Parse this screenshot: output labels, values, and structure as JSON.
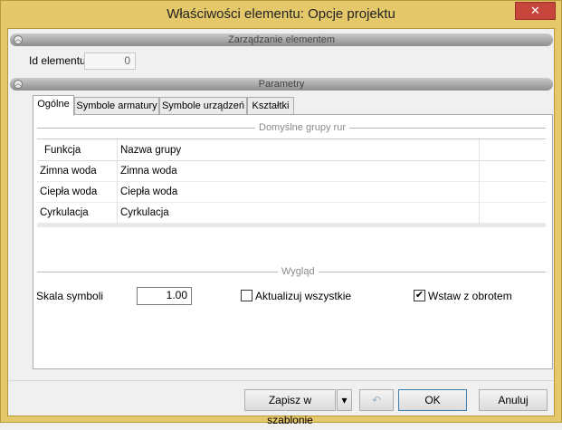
{
  "window": {
    "title": "Właściwości elementu: Opcje projektu",
    "close_glyph": "✕"
  },
  "sections": {
    "element_management": "Zarządzanie elementem",
    "parameters": "Parametry",
    "collapse_glyph": "︿"
  },
  "element": {
    "id_label": "Id elementu",
    "id_value": "0"
  },
  "tabs": [
    {
      "label": "Ogólne",
      "active": true
    },
    {
      "label": "Symbole armatury",
      "active": false
    },
    {
      "label": "Symbole urządzeń",
      "active": false
    },
    {
      "label": "Kształtki",
      "active": false
    }
  ],
  "pipe_groups": {
    "title": "Domyślne grupy rur",
    "columns": [
      "Funkcja",
      "Nazwa grupy"
    ],
    "rows": [
      {
        "function": "Zimna woda",
        "group": "Zimna woda"
      },
      {
        "function": "Ciepła woda",
        "group": "Ciepła woda"
      },
      {
        "function": "Cyrkulacja",
        "group": "Cyrkulacja"
      }
    ]
  },
  "appearance": {
    "title": "Wygląd",
    "scale_label": "Skala symboli",
    "scale_value": "1.00",
    "update_all_label": "Aktualizuj wszystkie",
    "update_all_checked": false,
    "insert_rotation_label": "Wstaw z obrotem",
    "insert_rotation_checked": true,
    "check_glyph": "✔"
  },
  "buttons": {
    "save_template": "Zapisz w szablonie",
    "dropdown_glyph": "▾",
    "undo_glyph": "↶",
    "ok": "OK",
    "cancel": "Anuluj"
  }
}
